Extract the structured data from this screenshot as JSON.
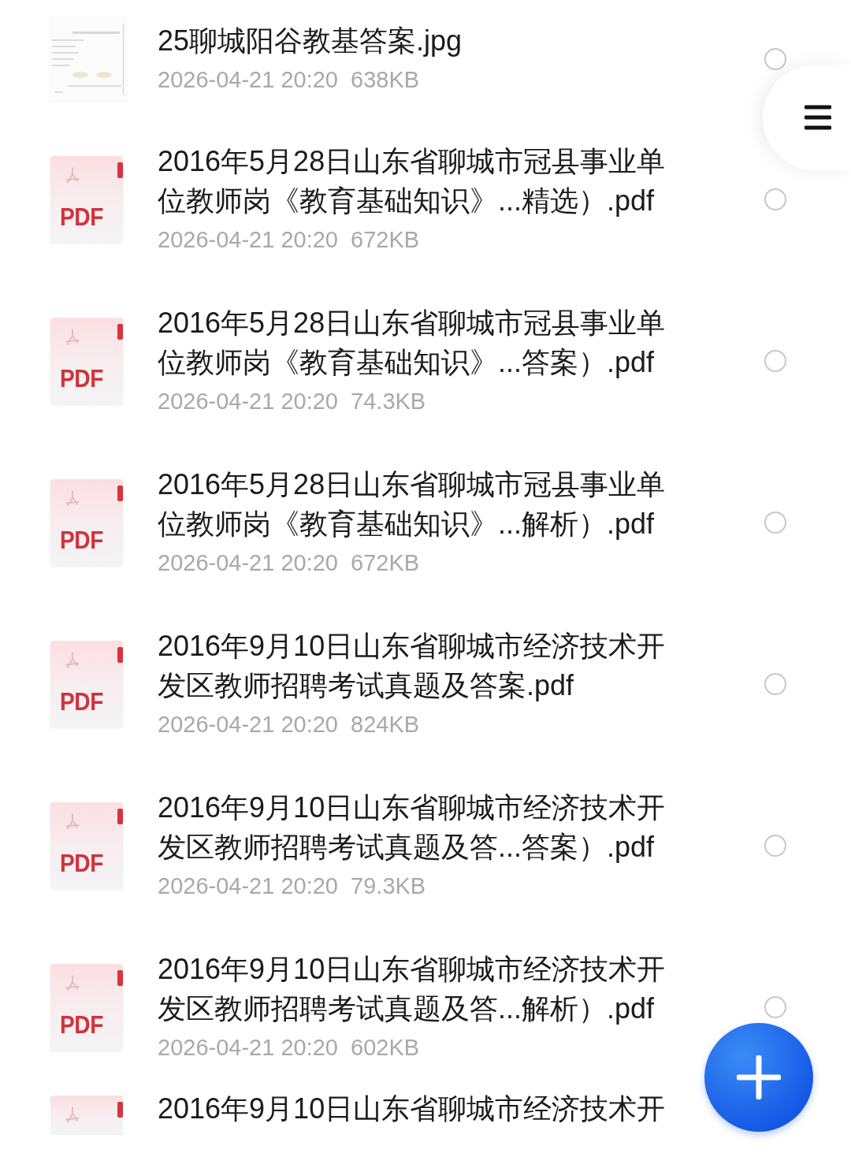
{
  "files": [
    {
      "title": "25聊城阳谷教基答案.jpg",
      "meta": "2026-04-21 20:20  638KB",
      "selected": false
    },
    {
      "kind": "pdf",
      "icon_label": "PDF",
      "title": "2016年5月28日山东省聊城市冠县事业单位教师岗《教育基础知识》...精选）.pdf",
      "meta": "2026-04-21 20:20  672KB",
      "selected": false
    },
    {
      "kind": "pdf",
      "icon_label": "PDF",
      "title": "2016年5月28日山东省聊城市冠县事业单位教师岗《教育基础知识》...答案）.pdf",
      "meta": "2026-04-21 20:20  74.3KB",
      "selected": false
    },
    {
      "kind": "pdf",
      "icon_label": "PDF",
      "title": "2016年5月28日山东省聊城市冠县事业单位教师岗《教育基础知识》...解析）.pdf",
      "meta": "2026-04-21 20:20  672KB",
      "selected": false
    },
    {
      "kind": "pdf",
      "icon_label": "PDF",
      "title": "2016年9月10日山东省聊城市经济技术开发区教师招聘考试真题及答案.pdf",
      "meta": "2026-04-21 20:20  824KB",
      "selected": false
    },
    {
      "kind": "pdf",
      "icon_label": "PDF",
      "title": "2016年9月10日山东省聊城市经济技术开发区教师招聘考试真题及答...答案）.pdf",
      "meta": "2026-04-21 20:20  79.3KB",
      "selected": false
    },
    {
      "kind": "pdf",
      "icon_label": "PDF",
      "title": "2016年9月10日山东省聊城市经济技术开发区教师招聘考试真题及答...解析）.pdf",
      "meta": "2026-04-21 20:20  602KB",
      "selected": false
    },
    {
      "kind": "pdf_partial",
      "title": "2016年9月10日山东省聊城市经济技术开"
    }
  ]
}
